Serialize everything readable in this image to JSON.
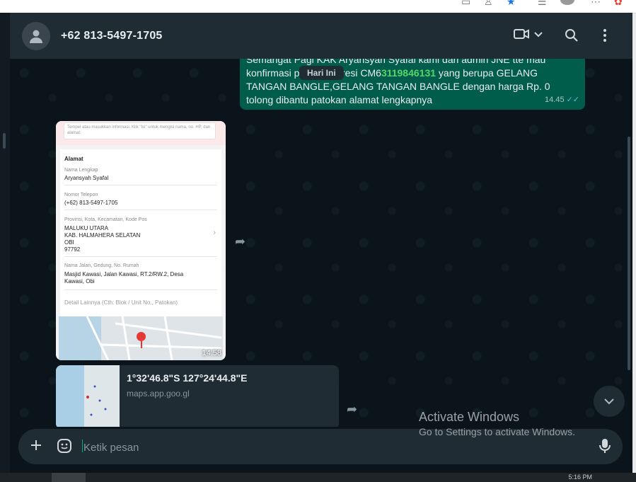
{
  "header": {
    "contact_name": "+62 813-5497-1705",
    "icons": [
      "video-call-icon",
      "chevron-down-icon",
      "search-icon",
      "menu-icon"
    ]
  },
  "messages": {
    "outgoing": {
      "text_before": "Semangat Pagi KAK Aryansyah Syafal kami dari admin JNE tte mau konfirmasi p",
      "text_mid": "an resi CM6",
      "link": "3119846131",
      "text_after": " yang berupa GELANG TANGAN BANGLE,GELANG TANGAN BANGLE dengan harga Rp. 0 tolong dibantu patokan alamat lengkapnya",
      "time": "14.45",
      "ticks": "✓✓"
    },
    "day_chip": "Hari Ini",
    "image": {
      "time": "14.58",
      "note": "Tempel atau masukkan informasi. Klik \"Isi\" untuk mengisi nama, no. HP, dan alamat.",
      "section_title": "Alamat",
      "fields": [
        {
          "label": "Nama Lengkap",
          "value": "Aryansyah Syafal"
        },
        {
          "label": "Nomor Telepon",
          "value": "(+62) 813-5497-1705"
        },
        {
          "label": "Provinsi, Kota, Kecamatan, Kode Pos",
          "value_lines": [
            "MALUKU UTARA",
            "KAB. HALMAHERA SELATAN",
            "OBI",
            "97792"
          ]
        },
        {
          "label": "Nama Jalan, Gedung, No. Rumah",
          "value_lines": [
            "Masjid Kawasi, Jalan Kawasi, RT.2/RW.2, Desa",
            "Kawasi, Obi"
          ]
        }
      ],
      "detail_placeholder": "Detail Lainnya (Cth: Blok / Unit No., Patokan)"
    },
    "location": {
      "title": "1°32'46.8\"S 127°24'44.8\"E",
      "url": "maps.app.goo.gl"
    }
  },
  "composer": {
    "placeholder": "Ketik pesan"
  },
  "watermark": {
    "title": "Activate Windows",
    "subtitle": "Go to Settings to activate Windows."
  },
  "taskbar": {
    "clock": "5:16 PM"
  },
  "colors": {
    "outgoing_bubble": "#005c4b",
    "header": "#202c33",
    "background": "#0b141a",
    "link_green": "#53d769",
    "tick_blue": "#53bdeb"
  }
}
